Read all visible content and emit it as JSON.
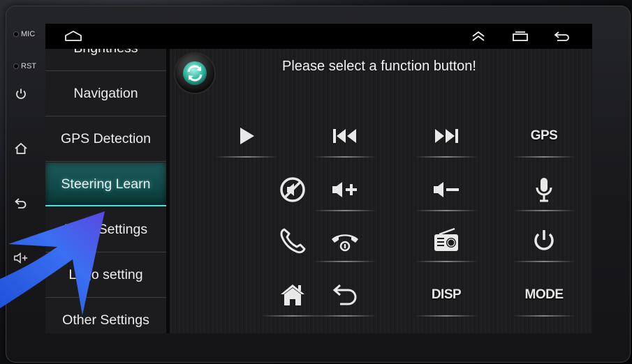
{
  "hardware": {
    "mic_label": "MIC",
    "rst_label": "RST",
    "buttons": [
      "power-icon",
      "home-icon",
      "back-icon",
      "volume-up-icon"
    ]
  },
  "statusbar": {
    "icons": [
      "home-outline-icon",
      "chevron-up-icon",
      "recent-apps-icon",
      "back-arrow-icon"
    ]
  },
  "sidebar": {
    "items": [
      {
        "label": "Brightness"
      },
      {
        "label": "Navigation"
      },
      {
        "label": "GPS Detection"
      },
      {
        "label": "Steering Learn",
        "active": true
      },
      {
        "label": "Logo Settings"
      },
      {
        "label": "Logo setting"
      },
      {
        "label": "Other Settings"
      }
    ]
  },
  "panel": {
    "prompt": "Please select a function button!",
    "refresh_icon": "refresh-icon",
    "functions": [
      {
        "icon": "play-icon"
      },
      {
        "icon": "previous-track-icon"
      },
      {
        "icon": "next-track-icon"
      },
      {
        "text": "GPS"
      },
      {
        "icon": "mute-icon"
      },
      {
        "icon": "volume-up-icon"
      },
      {
        "icon": "volume-down-icon"
      },
      {
        "icon": "microphone-icon"
      },
      {
        "icon": "phone-answer-icon"
      },
      {
        "icon": "phone-hangup-icon"
      },
      {
        "icon": "radio-icon"
      },
      {
        "icon": "power-icon"
      },
      {
        "icon": "home-icon"
      },
      {
        "icon": "back-icon"
      },
      {
        "text": "DISP"
      },
      {
        "text": "MODE"
      }
    ]
  },
  "colors": {
    "accent": "#1f5a5a",
    "accent_glow": "#4be0e0",
    "overlay_arrow": "#2f57e6"
  }
}
